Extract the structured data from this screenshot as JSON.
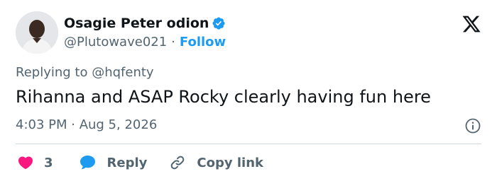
{
  "author": {
    "display_name": "Osagie Peter odion",
    "handle": "@Plutowave021",
    "separator": "·",
    "follow_label": "Follow",
    "verified": true
  },
  "reply_context": {
    "prefix": "Replying to",
    "mention": "@hqfenty"
  },
  "tweet": {
    "text": "Rihanna and ASAP Rocky clearly having fun here",
    "timestamp": "4:03 PM · Aug 5, 2026"
  },
  "actions": {
    "like_count": "3",
    "reply_label": "Reply",
    "copy_link_label": "Copy link"
  },
  "icons": {
    "brand": "x-logo-icon",
    "verified": "verified-badge-icon",
    "info": "info-icon",
    "like": "heart-icon",
    "reply": "speech-bubble-icon",
    "copy": "link-icon"
  },
  "colors": {
    "accent": "#1d9bf0",
    "like": "#f91880",
    "text_primary": "#0f1419",
    "text_secondary": "#536471",
    "divider": "#cfd9de"
  }
}
